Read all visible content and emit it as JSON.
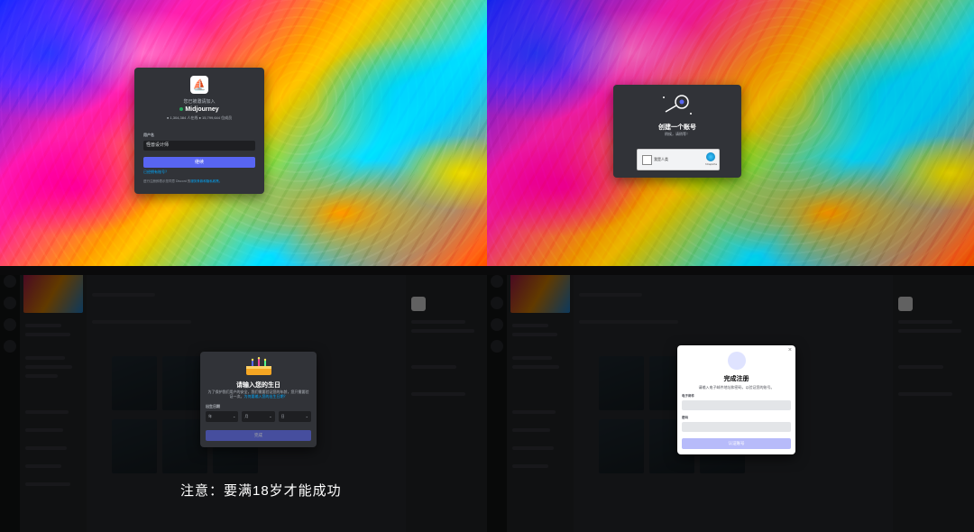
{
  "login": {
    "invited_text": "您已被邀请加入",
    "server_name": "Midjourney",
    "online": "1,304,384 人在线",
    "members": "15,799,644 位成员",
    "username_label": "用户名",
    "username_value": "怪兽设计师",
    "continue_button": "继续",
    "have_account_link": "已经拥有账号？",
    "terms_text": "进行注册即表示您同意 Discord 的",
    "terms_link": "服务条款和隐私政策。"
  },
  "create_account": {
    "title": "创建一个账号",
    "subtitle": "稍候，请稍等！",
    "captcha_label": "我是人类",
    "captcha_brand": "hCaptcha"
  },
  "birthday": {
    "title": "请输入您的生日",
    "description": "为了保护我们用户的安全，我们需要验证您的年龄，您只需要验证一次。",
    "description_link": "为何要输入您的出生日期？",
    "label": "出生日期",
    "year": "年",
    "month": "月",
    "day": "日",
    "submit_button": "完成"
  },
  "register": {
    "title": "完成注册",
    "subtitle": "请输入电子邮件地址和密码，以验证您的账号。",
    "email_label": "电子邮件",
    "password_label": "密码",
    "submit_button": "认证账号"
  },
  "note": "注意：要满18岁才能成功"
}
